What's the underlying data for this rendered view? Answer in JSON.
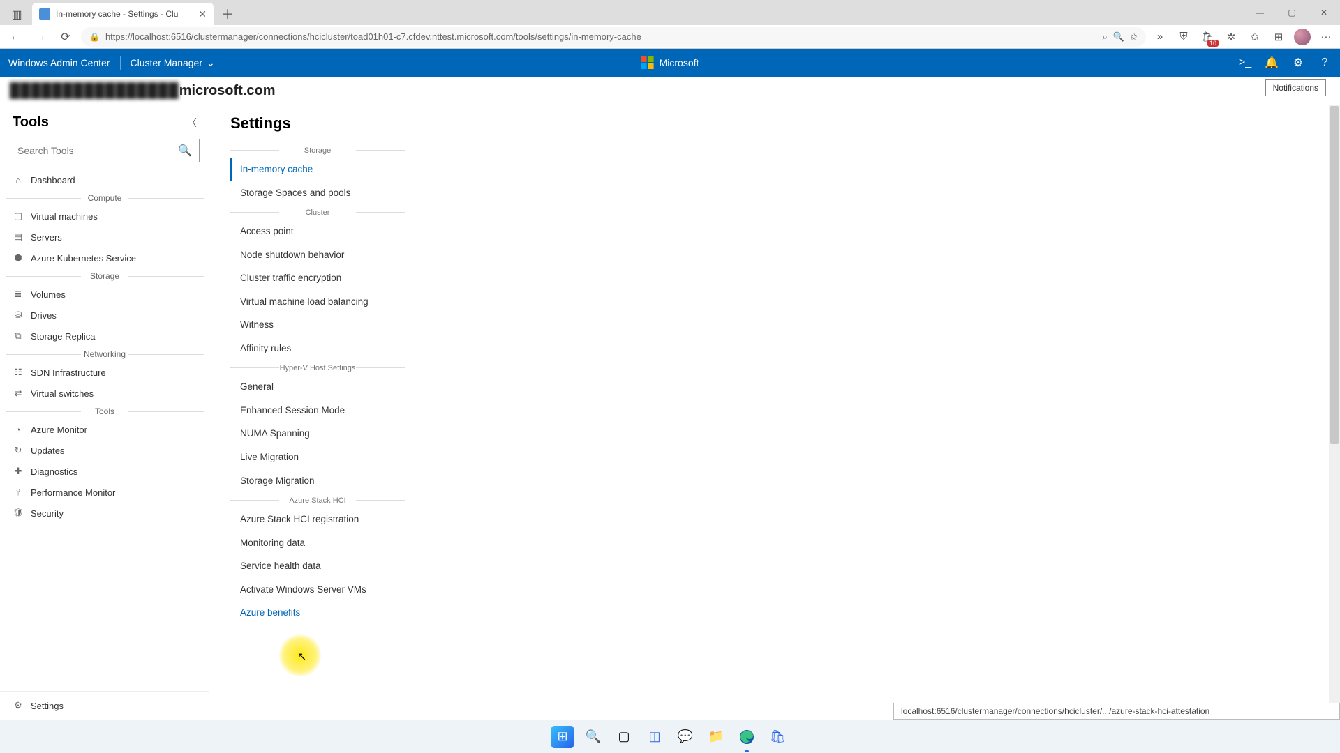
{
  "browser": {
    "tab_title": "In-memory cache - Settings - Clu",
    "url": "https://localhost:6516/clustermanager/connections/hcicluster/toad01h01-c7.cfdev.nttest.microsoft.com/tools/settings/in-memory-cache",
    "badge_count": "10"
  },
  "wac": {
    "product": "Windows Admin Center",
    "module": "Cluster Manager",
    "brand": "Microsoft",
    "notif_tooltip": "Notifications"
  },
  "cluster": {
    "domain_suffix": "microsoft.com"
  },
  "tools": {
    "title": "Tools",
    "search_placeholder": "Search Tools",
    "groups": [
      {
        "label": "",
        "items": [
          {
            "icon": "⌂",
            "label": "Dashboard"
          }
        ]
      },
      {
        "label": "Compute",
        "items": [
          {
            "icon": "▢",
            "label": "Virtual machines"
          },
          {
            "icon": "▤",
            "label": "Servers"
          },
          {
            "icon": "⬢",
            "label": "Azure Kubernetes Service"
          }
        ]
      },
      {
        "label": "Storage",
        "items": [
          {
            "icon": "≣",
            "label": "Volumes"
          },
          {
            "icon": "⛁",
            "label": "Drives"
          },
          {
            "icon": "⧉",
            "label": "Storage Replica"
          }
        ]
      },
      {
        "label": "Networking",
        "items": [
          {
            "icon": "☷",
            "label": "SDN Infrastructure"
          },
          {
            "icon": "⇄",
            "label": "Virtual switches"
          }
        ]
      },
      {
        "label": "Tools",
        "items": [
          {
            "icon": "◔",
            "label": "Azure Monitor"
          },
          {
            "icon": "↻",
            "label": "Updates"
          },
          {
            "icon": "✚",
            "label": "Diagnostics"
          },
          {
            "icon": "⫯",
            "label": "Performance Monitor"
          },
          {
            "icon": "🛡",
            "label": "Security"
          }
        ]
      }
    ],
    "footer": {
      "icon": "⚙",
      "label": "Settings"
    }
  },
  "settings": {
    "title": "Settings",
    "groups": [
      {
        "label": "Storage",
        "items": [
          {
            "label": "In-memory cache",
            "active": true
          },
          {
            "label": "Storage Spaces and pools"
          }
        ]
      },
      {
        "label": "Cluster",
        "items": [
          {
            "label": "Access point"
          },
          {
            "label": "Node shutdown behavior"
          },
          {
            "label": "Cluster traffic encryption"
          },
          {
            "label": "Virtual machine load balancing"
          },
          {
            "label": "Witness"
          },
          {
            "label": "Affinity rules"
          }
        ]
      },
      {
        "label": "Hyper-V Host Settings",
        "items": [
          {
            "label": "General"
          },
          {
            "label": "Enhanced Session Mode"
          },
          {
            "label": "NUMA Spanning"
          },
          {
            "label": "Live Migration"
          },
          {
            "label": "Storage Migration"
          }
        ]
      },
      {
        "label": "Azure Stack HCI",
        "items": [
          {
            "label": "Azure Stack HCI registration"
          },
          {
            "label": "Monitoring data"
          },
          {
            "label": "Service health data"
          },
          {
            "label": "Activate Windows Server VMs"
          },
          {
            "label": "Azure benefits",
            "hovered": true
          }
        ]
      }
    ]
  },
  "status_url": "localhost:6516/clustermanager/connections/hcicluster/.../azure-stack-hci-attestation"
}
